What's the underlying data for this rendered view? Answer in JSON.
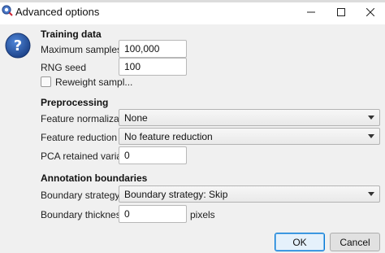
{
  "window": {
    "title": "Advanced options",
    "icon": "qupath-app-icon",
    "controls": [
      "minimize-icon",
      "maximize-icon",
      "close-icon"
    ]
  },
  "help": {
    "icon": "help-question-icon",
    "glyph": "?"
  },
  "training": {
    "heading": "Training data",
    "max_samples_label": "Maximum samples",
    "max_samples_value": "100,000",
    "rng_seed_label": "RNG seed",
    "rng_seed_value": "100",
    "reweight_label": "Reweight sampl...",
    "reweight_checked": false
  },
  "preprocessing": {
    "heading": "Preprocessing",
    "feature_normalization_label": "Feature normalization",
    "feature_normalization_value": "None",
    "feature_reduction_label": "Feature reduction",
    "feature_reduction_value": "No feature reduction",
    "pca_label": "PCA retained variance",
    "pca_value": "0"
  },
  "annotation": {
    "heading": "Annotation boundaries",
    "boundary_strategy_label": "Boundary strategy",
    "boundary_strategy_value": "Boundary strategy: Skip",
    "boundary_thickness_label": "Boundary thickness",
    "boundary_thickness_value": "0",
    "boundary_thickness_unit": "pixels"
  },
  "buttons": {
    "ok": "OK",
    "cancel": "Cancel"
  },
  "colors": {
    "accent": "#0078d7",
    "help_blue": "#1f4f9a",
    "dialog_bg": "#f0f0f0"
  }
}
